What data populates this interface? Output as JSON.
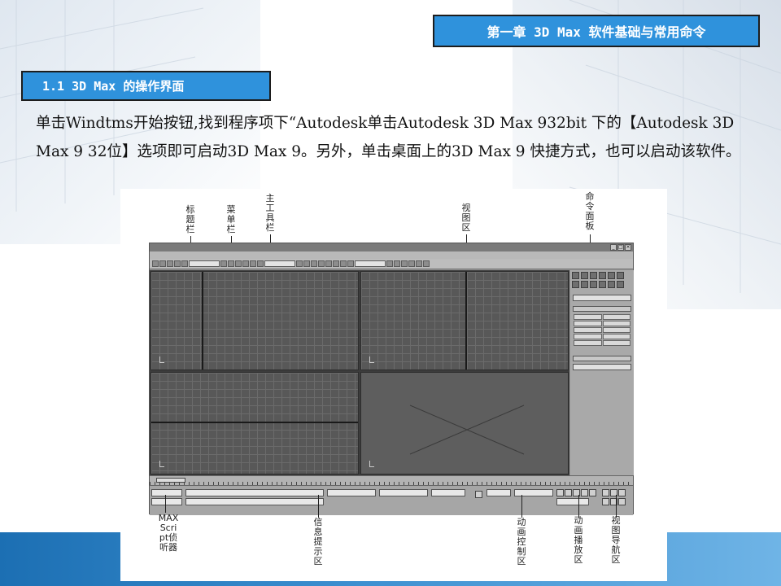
{
  "header": {
    "chapter_title": "第一章 3D Max 软件基础与常用命令",
    "section_title": "1.1 3D Max 的操作界面"
  },
  "body": {
    "paragraph": "单击Windtms开始按钮,找到程序项下“Autodesk单击Autodesk 3D Max 932bit 下的【Autodesk 3D Max 9 32位】选项即可启动3D Max 9。另外，单击桌面上的3D Max 9 快捷方式，也可以启动该软件。"
  },
  "figure": {
    "callouts_top": {
      "title_bar": "标题栏",
      "menu_bar": "菜单栏",
      "main_toolbar": "主工具栏",
      "viewport_area": "视图区",
      "command_panel": "命令面板"
    },
    "callouts_bottom": {
      "maxscript_listener": "MAXScript侦听器",
      "info_prompt": "信息提示区",
      "animation_control": "动画控制区",
      "animation_playback": "动画播放区",
      "viewport_navigation": "视图导航区"
    }
  },
  "colors": {
    "header_box": "#2f92dc",
    "header_text": "#ffffff",
    "bottom_band": "#1c6fb3"
  }
}
